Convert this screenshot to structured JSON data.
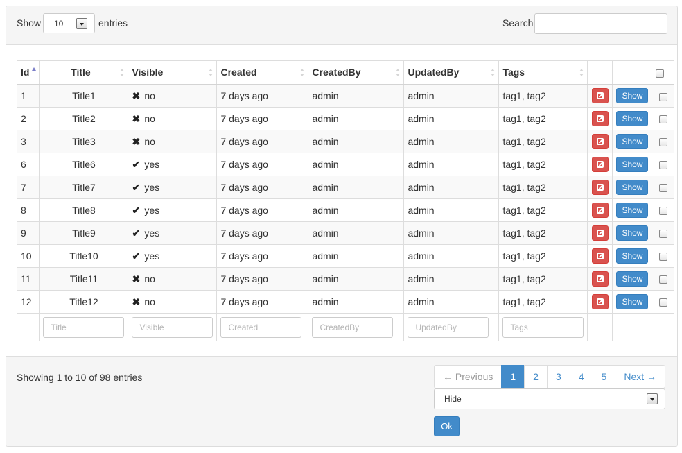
{
  "length_menu": {
    "show_label": "Show",
    "value": "10",
    "entries_label": "entries"
  },
  "search": {
    "label": "Search",
    "value": "",
    "placeholder": ""
  },
  "table": {
    "headers": {
      "id": "Id",
      "title": "Title",
      "visible": "Visible",
      "created": "Created",
      "created_by": "CreatedBy",
      "updated_by": "UpdatedBy",
      "tags": "Tags"
    },
    "rows": [
      {
        "id": "1",
        "title": "Title1",
        "visible": "no",
        "created": "7 days ago",
        "created_by": "admin",
        "updated_by": "admin",
        "tags": "tag1, tag2"
      },
      {
        "id": "2",
        "title": "Title2",
        "visible": "no",
        "created": "7 days ago",
        "created_by": "admin",
        "updated_by": "admin",
        "tags": "tag1, tag2"
      },
      {
        "id": "3",
        "title": "Title3",
        "visible": "no",
        "created": "7 days ago",
        "created_by": "admin",
        "updated_by": "admin",
        "tags": "tag1, tag2"
      },
      {
        "id": "6",
        "title": "Title6",
        "visible": "yes",
        "created": "7 days ago",
        "created_by": "admin",
        "updated_by": "admin",
        "tags": "tag1, tag2"
      },
      {
        "id": "7",
        "title": "Title7",
        "visible": "yes",
        "created": "7 days ago",
        "created_by": "admin",
        "updated_by": "admin",
        "tags": "tag1, tag2"
      },
      {
        "id": "8",
        "title": "Title8",
        "visible": "yes",
        "created": "7 days ago",
        "created_by": "admin",
        "updated_by": "admin",
        "tags": "tag1, tag2"
      },
      {
        "id": "9",
        "title": "Title9",
        "visible": "yes",
        "created": "7 days ago",
        "created_by": "admin",
        "updated_by": "admin",
        "tags": "tag1, tag2"
      },
      {
        "id": "10",
        "title": "Title10",
        "visible": "yes",
        "created": "7 days ago",
        "created_by": "admin",
        "updated_by": "admin",
        "tags": "tag1, tag2"
      },
      {
        "id": "11",
        "title": "Title11",
        "visible": "no",
        "created": "7 days ago",
        "created_by": "admin",
        "updated_by": "admin",
        "tags": "tag1, tag2"
      },
      {
        "id": "12",
        "title": "Title12",
        "visible": "no",
        "created": "7 days ago",
        "created_by": "admin",
        "updated_by": "admin",
        "tags": "tag1, tag2"
      }
    ],
    "show_button_label": "Show",
    "icons": {
      "yes": "check-icon",
      "no": "cross-icon",
      "edit": "edit-icon"
    },
    "filter_placeholders": {
      "title": "Title",
      "visible": "Visible",
      "created": "Created",
      "created_by": "CreatedBy",
      "updated_by": "UpdatedBy",
      "tags": "Tags"
    }
  },
  "footer": {
    "info": "Showing 1 to 10 of 98 entries",
    "pagination": {
      "previous": "← Previous",
      "pages": [
        "1",
        "2",
        "3",
        "4",
        "5"
      ],
      "active": "1",
      "next": "Next →"
    },
    "bulk_action": {
      "value": "Hide"
    },
    "ok_label": "Ok"
  },
  "colors": {
    "primary": "#428bca",
    "danger": "#d9534f",
    "panel_bg": "#f5f5f5"
  }
}
